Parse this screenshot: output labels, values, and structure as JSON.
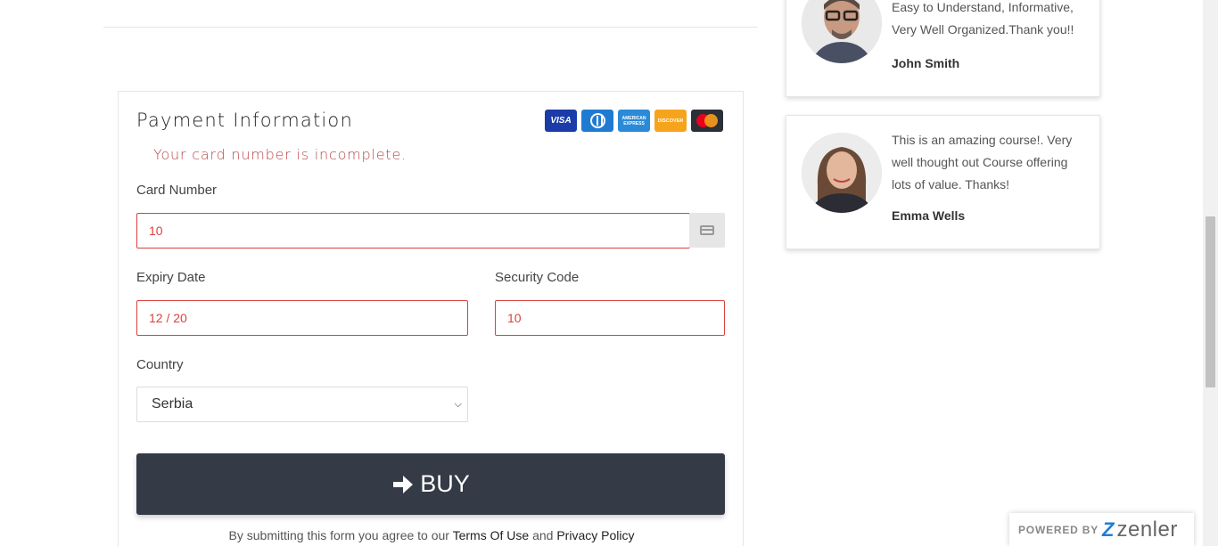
{
  "payment": {
    "title": "Payment Information",
    "error": "Your card number is incomplete.",
    "card_brands": [
      "VISA",
      "Diners",
      "AMERICAN EXPRESS",
      "DISCOVER",
      "Mastercard"
    ],
    "card_number_label": "Card Number",
    "card_number_value": "10",
    "expiry_label": "Expiry Date",
    "expiry_value": "12 / 20",
    "security_label": "Security Code",
    "security_value": "10",
    "country_label": "Country",
    "country_value": "Serbia",
    "buy_label": "BUY",
    "terms_prefix": "By submitting this form you agree to our ",
    "terms_link": "Terms Of Use",
    "terms_and": " and ",
    "privacy_link": "Privacy Policy"
  },
  "testimonials": [
    {
      "text": "Easy to Understand, Informative, Very Well Organized.Thank you!!",
      "name": "John Smith"
    },
    {
      "text": "This is an amazing course!. Very well thought out Course offering lots of value. Thanks!",
      "name": "Emma Wells"
    }
  ],
  "footer_badge": {
    "powered": "POWERED BY",
    "brand": "zenler"
  },
  "colors": {
    "error": "#d9413f",
    "button": "#343a46",
    "zenler_blue": "#1f7fd6"
  }
}
